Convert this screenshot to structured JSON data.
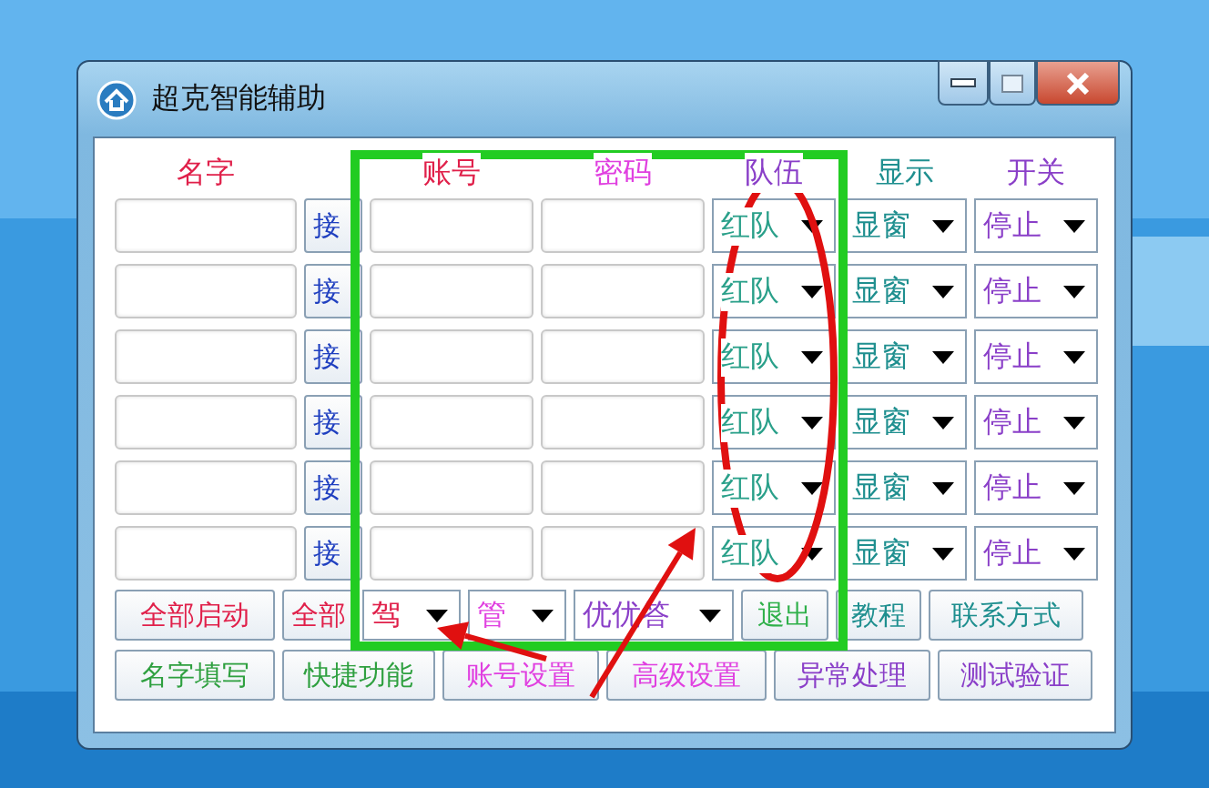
{
  "window": {
    "title": "超克智能辅助"
  },
  "headers": [
    {
      "label": "名字",
      "color": "#e0204a"
    },
    {
      "label": "账号",
      "color": "#e0204a"
    },
    {
      "label": "密码",
      "color": "#e040e0"
    },
    {
      "label": "队伍",
      "color": "#8a3fc8"
    },
    {
      "label": "显示",
      "color": "#1f8f8f"
    },
    {
      "label": "开关",
      "color": "#8a3fc8"
    }
  ],
  "rows": [
    {
      "button": "接",
      "team": "红队",
      "display": "显窗",
      "switch": "停止"
    },
    {
      "button": "接",
      "team": "红队",
      "display": "显窗",
      "switch": "停止"
    },
    {
      "button": "接",
      "team": "红队",
      "display": "显窗",
      "switch": "停止"
    },
    {
      "button": "接",
      "team": "红队",
      "display": "显窗",
      "switch": "停止"
    },
    {
      "button": "接",
      "team": "红队",
      "display": "显窗",
      "switch": "停止"
    },
    {
      "button": "接",
      "team": "红队",
      "display": "显窗",
      "switch": "停止"
    }
  ],
  "bottom_row_1": [
    {
      "kind": "button",
      "label": "全部启动",
      "color": "#e0204a"
    },
    {
      "kind": "button",
      "label": "全部",
      "color": "#e0204a"
    },
    {
      "kind": "dropdown",
      "label": "驾",
      "color": "#e0204a"
    },
    {
      "kind": "dropdown",
      "label": "管",
      "color": "#e040e0"
    },
    {
      "kind": "dropdown",
      "label": "优优答",
      "color": "#8a3fc8"
    },
    {
      "kind": "button",
      "label": "退出",
      "color": "#2fb04a"
    },
    {
      "kind": "button",
      "label": "教程",
      "color": "#1f8f8f"
    },
    {
      "kind": "button",
      "label": "联系方式",
      "color": "#1f8f8f"
    }
  ],
  "bottom_row_2": [
    {
      "kind": "button",
      "label": "名字填写",
      "color": "#2fa040"
    },
    {
      "kind": "button",
      "label": "快捷功能",
      "color": "#2fa040"
    },
    {
      "kind": "button",
      "label": "账号设置",
      "color": "#e040e0"
    },
    {
      "kind": "button",
      "label": "高级设置",
      "color": "#e040e0"
    },
    {
      "kind": "button",
      "label": "异常处理",
      "color": "#8a3fc8"
    },
    {
      "kind": "button",
      "label": "测试验证",
      "color": "#8a3fc8"
    }
  ],
  "annotations": [
    {
      "kind": "rectangle"
    },
    {
      "kind": "ellipse"
    },
    {
      "kind": "arrow"
    },
    {
      "kind": "arrow"
    }
  ]
}
